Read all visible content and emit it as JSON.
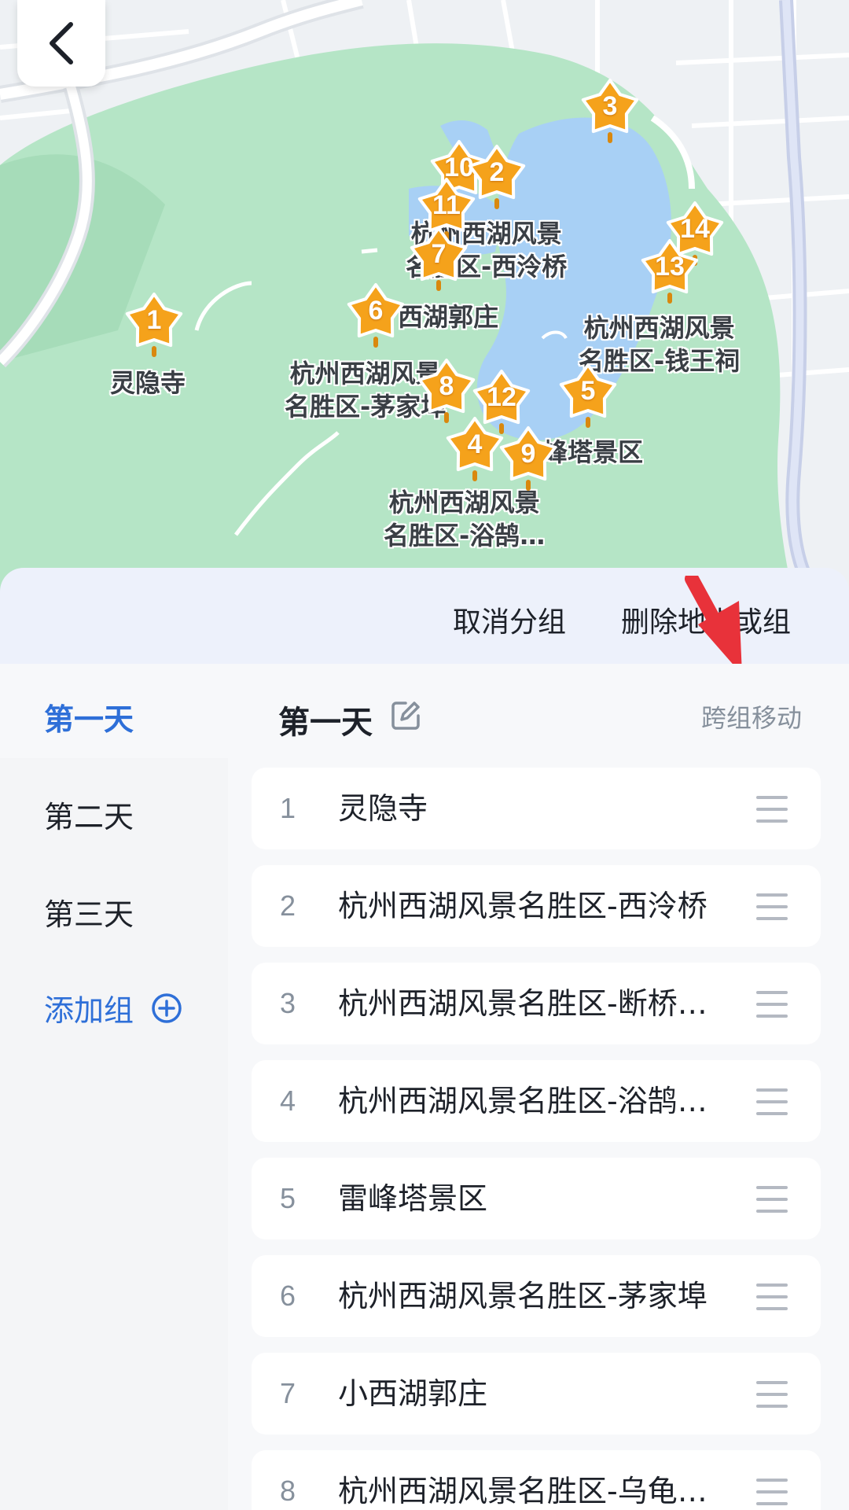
{
  "map": {
    "pins": [
      "1",
      "10",
      "2",
      "3",
      "11",
      "7",
      "14",
      "13",
      "6",
      "8",
      "12",
      "5",
      "4",
      "9"
    ],
    "labels": {
      "lingyin": "灵隐寺",
      "xiling": [
        "杭州西湖风景",
        "名胜区-西泠桥"
      ],
      "guozhuang": "西湖郭庄",
      "qianwang": [
        "杭州西湖风景",
        "名胜区-钱王祠"
      ],
      "maojia": [
        "杭州西湖风景",
        "名胜区-茅家埠"
      ],
      "leifeng": "峰塔景区",
      "yuhu": [
        "杭州西湖风景",
        "名胜区-浴鹄…"
      ]
    }
  },
  "actions": {
    "cancel_group": "取消分组",
    "delete_place": "删除地点或组"
  },
  "sidebar": {
    "items": [
      {
        "label": "第一天"
      },
      {
        "label": "第二天"
      },
      {
        "label": "第三天"
      }
    ],
    "add_group": "添加组"
  },
  "main": {
    "group_title": "第一天",
    "cross_move": "跨组移动",
    "places": [
      {
        "index": "1",
        "name": "灵隐寺"
      },
      {
        "index": "2",
        "name": "杭州西湖风景名胜区-西泠桥"
      },
      {
        "index": "3",
        "name": "杭州西湖风景名胜区-断桥…"
      },
      {
        "index": "4",
        "name": "杭州西湖风景名胜区-浴鹄…"
      },
      {
        "index": "5",
        "name": "雷峰塔景区"
      },
      {
        "index": "6",
        "name": "杭州西湖风景名胜区-茅家埠"
      },
      {
        "index": "7",
        "name": "小西湖郭庄"
      },
      {
        "index": "8",
        "name": "杭州西湖风景名胜区-乌龟…"
      }
    ]
  },
  "colors": {
    "accent": "#2e6fd8",
    "pin": "#f5a21b",
    "water": "#a8d0f5",
    "park": "#b5e5c6",
    "arrow": "#e8323a"
  },
  "icons": {
    "back": "chevron-left-icon",
    "edit": "edit-icon",
    "add": "plus-circle-icon",
    "drag": "drag-handle-icon",
    "pin": "star-pin-icon"
  }
}
